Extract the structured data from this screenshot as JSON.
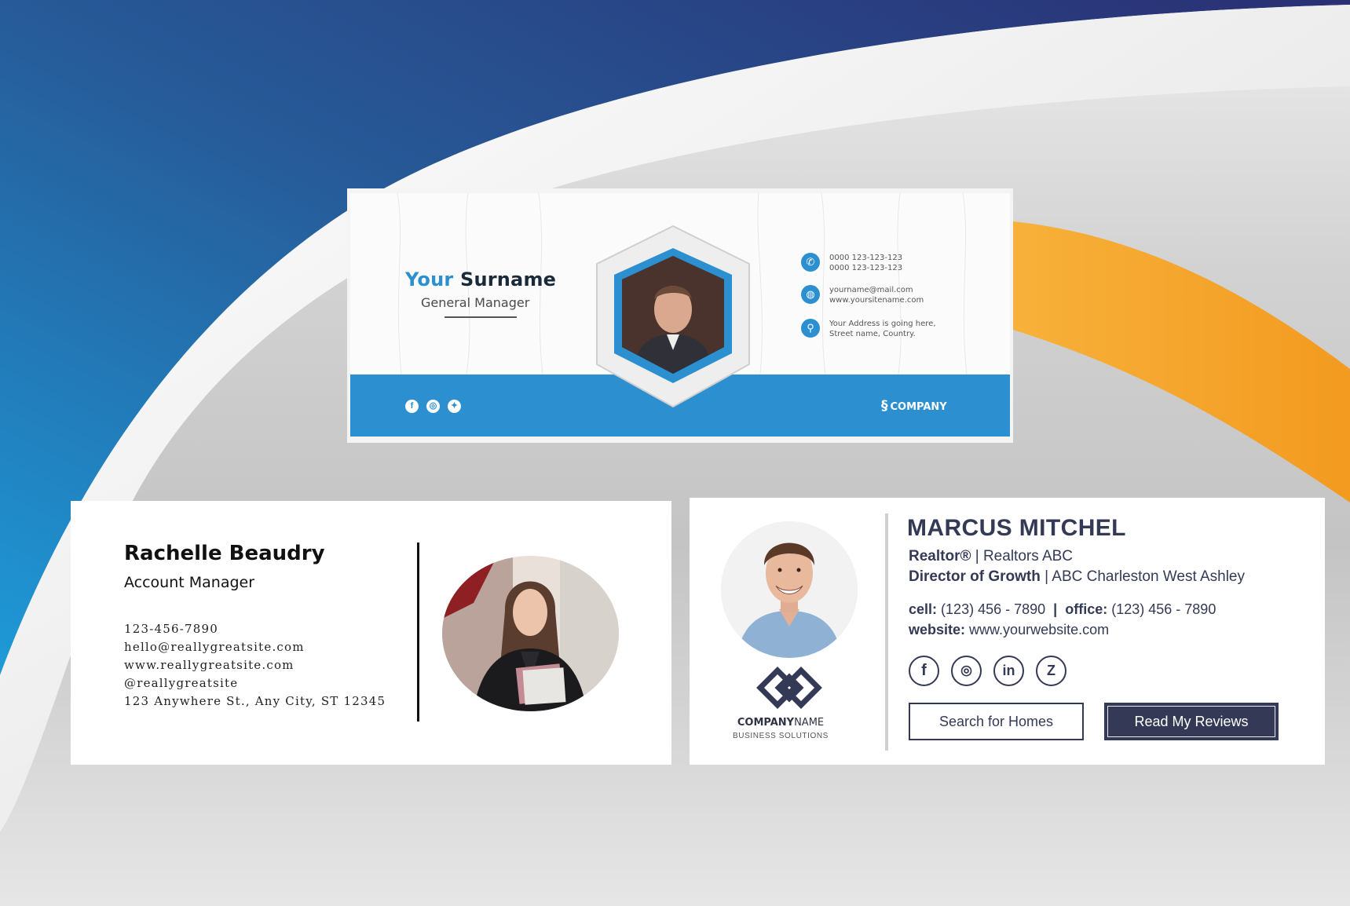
{
  "background": {
    "colors": {
      "blue_dark": "#2a2f73",
      "blue": "#1f86c9",
      "orange": "#f5a028",
      "white": "#ffffff",
      "grey": "#c4c4c4"
    }
  },
  "signature_1": {
    "name_first": "Your",
    "name_last": "Surname",
    "title": "General Manager",
    "phone_line1": "0000 123-123-123",
    "phone_line2": "0000 123-123-123",
    "email": "yourname@mail.com",
    "website": "www.yoursitename.com",
    "address_line1": "Your Address is going here,",
    "address_line2": "Street name, Country.",
    "company": "COMPANY",
    "social_icons": [
      "facebook-icon",
      "instagram-icon",
      "twitter-icon"
    ],
    "accent_color": "#2b8fd0"
  },
  "signature_2": {
    "name": "Rachelle Beaudry",
    "title": "Account Manager",
    "phone": "123-456-7890",
    "email": "hello@reallygreatsite.com",
    "website": "www.reallygreatsite.com",
    "handle": "@reallygreatsite",
    "address": "123 Anywhere St., Any City, ST 12345"
  },
  "signature_3": {
    "name": "MARCUS MITCHEL",
    "role1_bold": "Realtor®",
    "role1_rest": "| Realtors ABC",
    "role2_bold": "Director of Growth",
    "role2_rest": "| ABC Charleston West Ashley",
    "cell_label": "cell:",
    "cell_value": "(123) 456 - 7890",
    "separator": "|",
    "office_label": "office:",
    "office_value": "(123) 456 - 7890",
    "website_label": "website:",
    "website_value": "www.yourwebsite.com",
    "company_bold": "COMPANY",
    "company_rest": "NAME",
    "company_tagline": "BUSINESS SOLUTIONS",
    "social_icons": [
      "facebook-icon",
      "instagram-icon",
      "linkedin-icon",
      "zillow-icon"
    ],
    "button_search": "Search for Homes",
    "button_reviews": "Read My Reviews",
    "accent_color": "#343a55"
  }
}
